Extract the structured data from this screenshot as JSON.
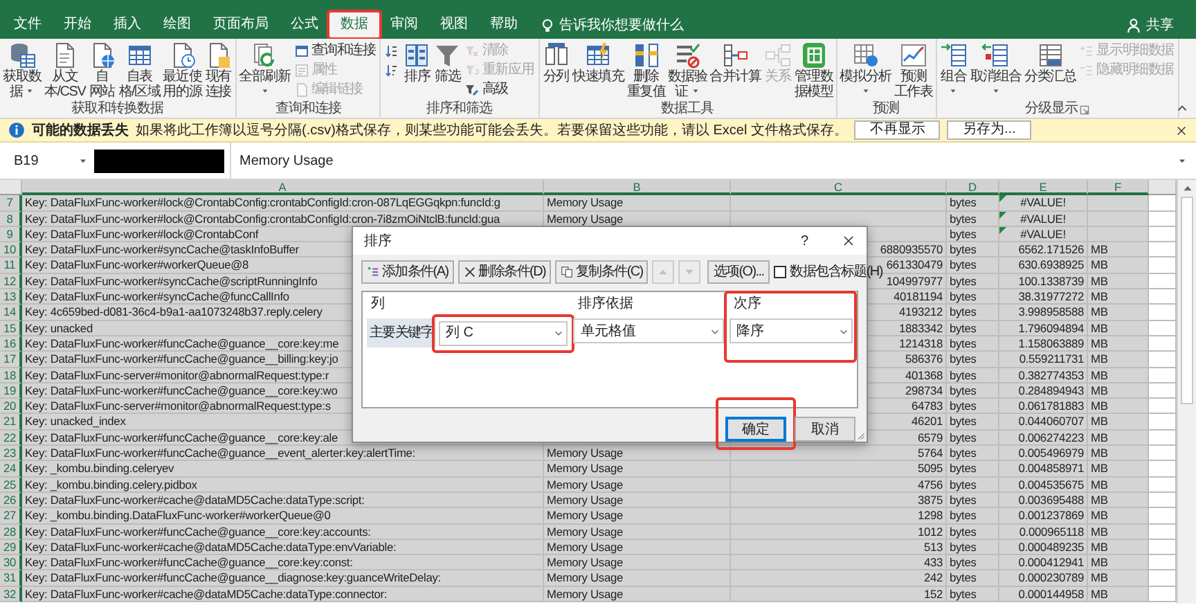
{
  "ribbon_tabs": [
    {
      "label": "文件",
      "selected": false,
      "highlighted": false
    },
    {
      "label": "开始",
      "selected": false,
      "highlighted": false
    },
    {
      "label": "插入",
      "selected": false,
      "highlighted": false
    },
    {
      "label": "绘图",
      "selected": false,
      "highlighted": false
    },
    {
      "label": "页面布局",
      "selected": false,
      "highlighted": false
    },
    {
      "label": "公式",
      "selected": false,
      "highlighted": false
    },
    {
      "label": "数据",
      "selected": true,
      "highlighted": true
    },
    {
      "label": "审阅",
      "selected": false,
      "highlighted": false
    },
    {
      "label": "视图",
      "selected": false,
      "highlighted": false
    },
    {
      "label": "帮助",
      "selected": false,
      "highlighted": false
    }
  ],
  "tell_me": "告诉我你想要做什么",
  "share": "共享",
  "ribbon_groups": [
    {
      "caption": "获取和转换数据",
      "items": [
        {
          "kind": "large",
          "label": [
            "获取数",
            "据"
          ],
          "dropdown": true,
          "disabled": false
        },
        {
          "kind": "large",
          "label": [
            "从文",
            "本/CSV"
          ],
          "dropdown": false,
          "disabled": false
        },
        {
          "kind": "large",
          "label": [
            "自",
            "网站"
          ],
          "dropdown": false,
          "disabled": false
        },
        {
          "kind": "large",
          "label": [
            "自表",
            "格/区域"
          ],
          "dropdown": false,
          "disabled": false
        },
        {
          "kind": "large",
          "label": [
            "最近使",
            "用的源"
          ],
          "dropdown": false,
          "disabled": false
        },
        {
          "kind": "large",
          "label": [
            "现有",
            "连接"
          ],
          "dropdown": false,
          "disabled": false
        }
      ]
    },
    {
      "caption": "查询和连接",
      "items": [
        {
          "kind": "large",
          "label": [
            "全部刷新"
          ],
          "dropdown": true,
          "disabled": false
        },
        {
          "kind": "stack",
          "items": [
            {
              "label": "查询和连接",
              "disabled": false
            },
            {
              "label": "属性",
              "disabled": true
            },
            {
              "label": "编辑链接",
              "disabled": true
            }
          ]
        }
      ]
    },
    {
      "caption": "排序和筛选",
      "items": [
        {
          "kind": "stack",
          "items": [
            {
              "disabled": false
            },
            {
              "disabled": false
            }
          ]
        },
        {
          "kind": "large",
          "label": [
            "排序"
          ],
          "dropdown": false,
          "disabled": false
        },
        {
          "kind": "large",
          "label": [
            "筛选"
          ],
          "dropdown": false,
          "disabled": false
        },
        {
          "kind": "stack",
          "items": [
            {
              "label": "清除",
              "disabled": true
            },
            {
              "label": "重新应用",
              "disabled": true
            },
            {
              "label": "高级",
              "disabled": false
            }
          ]
        }
      ]
    },
    {
      "caption": "数据工具",
      "items": [
        {
          "kind": "large",
          "label": [
            "分列"
          ],
          "dropdown": false,
          "disabled": false
        },
        {
          "kind": "large",
          "label": [
            "快速填充"
          ],
          "dropdown": false,
          "disabled": false
        },
        {
          "kind": "large",
          "label": [
            "删除",
            "重复值"
          ],
          "dropdown": false,
          "disabled": false
        },
        {
          "kind": "large",
          "label": [
            "数据验",
            "证"
          ],
          "dropdown": true,
          "disabled": false
        },
        {
          "kind": "large",
          "label": [
            "合并计算"
          ],
          "dropdown": false,
          "disabled": false
        },
        {
          "kind": "large",
          "label": [
            "关系"
          ],
          "dropdown": false,
          "disabled": true
        },
        {
          "kind": "large",
          "label": [
            "管理数",
            "据模型"
          ],
          "dropdown": false,
          "disabled": false
        }
      ]
    },
    {
      "caption": "预测",
      "items": [
        {
          "kind": "large",
          "label": [
            "模拟分析"
          ],
          "dropdown": true,
          "disabled": false
        },
        {
          "kind": "large",
          "label": [
            "预测",
            "工作表"
          ],
          "dropdown": false,
          "disabled": false
        }
      ]
    },
    {
      "caption": "分级显示",
      "launcher": true,
      "items": [
        {
          "kind": "large",
          "label": [
            "组合"
          ],
          "dropdown": true,
          "disabled": false
        },
        {
          "kind": "large",
          "label": [
            "取消组合"
          ],
          "dropdown": true,
          "disabled": false
        },
        {
          "kind": "large",
          "label": [
            "分类汇总"
          ],
          "dropdown": false,
          "disabled": false
        },
        {
          "kind": "stack",
          "items": [
            {
              "label": "显示明细数据",
              "disabled": true
            },
            {
              "label": "隐藏明细数据",
              "disabled": true
            }
          ]
        }
      ]
    }
  ],
  "notification": {
    "title": "可能的数据丢失",
    "message": "如果将此工作簿以逗号分隔(.csv)格式保存，则某些功能可能会丢失。若要保留这些功能，请以 Excel 文件格式保存。",
    "buttons": [
      "不再显示",
      "另存为..."
    ]
  },
  "formula_bar": {
    "name_box": "B19",
    "formula": "Memory Usage"
  },
  "sheet": {
    "columns": [
      {
        "label": "A",
        "selected": true
      },
      {
        "label": "B",
        "selected": true
      },
      {
        "label": "C",
        "selected": true
      },
      {
        "label": "D",
        "selected": true
      },
      {
        "label": "E",
        "selected": true
      },
      {
        "label": "F",
        "selected": true
      }
    ],
    "rows": [
      {
        "n": "7",
        "selected": true,
        "a": "Key: DataFluxFunc-worker#lock@CrontabConfig:crontabConfigId:cron-087LqEGGqkpn:funcId:g",
        "b": "Memory Usage",
        "d": "bytes",
        "e": "#VALUE!",
        "error": true
      },
      {
        "n": "8",
        "selected": true,
        "a": "Key: DataFluxFunc-worker#lock@CrontabConfig:crontabConfigId:cron-7i8zmOiNtclB:funcId:gua",
        "b": "Memory Usage",
        "d": "bytes",
        "e": "#VALUE!",
        "error": true
      },
      {
        "n": "9",
        "selected": true,
        "a": "Key: DataFluxFunc-worker#lock@CrontabConf",
        "d": "bytes",
        "e": "#VALUE!",
        "error": true
      },
      {
        "n": "10",
        "selected": true,
        "a": "Key: DataFluxFunc-worker#syncCache@taskInfoBuffer",
        "c": "6880935570",
        "d": "bytes",
        "e": "6562.171526",
        "f": "MB",
        "error": false
      },
      {
        "n": "11",
        "selected": true,
        "a": "Key: DataFluxFunc-worker#workerQueue@8",
        "c": "661330479",
        "d": "bytes",
        "e": "630.6938925",
        "f": "MB",
        "error": false
      },
      {
        "n": "12",
        "selected": true,
        "a": "Key: DataFluxFunc-worker#syncCache@scriptRunningInfo",
        "c": "104997977",
        "d": "bytes",
        "e": "100.1338739",
        "f": "MB",
        "error": false
      },
      {
        "n": "13",
        "selected": true,
        "a": "Key: DataFluxFunc-worker#syncCache@funcCallInfo",
        "c": "40181194",
        "d": "bytes",
        "e": "38.31977272",
        "f": "MB",
        "error": false
      },
      {
        "n": "14",
        "selected": true,
        "a": "Key: 4c659bed-d081-36c4-b9a1-aa1073248b37.reply.celery",
        "c": "4193212",
        "d": "bytes",
        "e": "3.998958588",
        "f": "MB",
        "error": false
      },
      {
        "n": "15",
        "selected": true,
        "a": "Key: unacked",
        "c": "1883342",
        "d": "bytes",
        "e": "1.796094894",
        "f": "MB",
        "error": false
      },
      {
        "n": "16",
        "selected": true,
        "a": "Key: DataFluxFunc-worker#funcCache@guance__core:key:me",
        "c": "1214318",
        "d": "bytes",
        "e": "1.158063889",
        "f": "MB",
        "error": false
      },
      {
        "n": "17",
        "selected": true,
        "a": "Key: DataFluxFunc-worker#funcCache@guance__billing:key:jo",
        "c": "586376",
        "d": "bytes",
        "e": "0.559211731",
        "f": "MB",
        "error": false
      },
      {
        "n": "18",
        "selected": true,
        "a": "Key: DataFluxFunc-server#monitor@abnormalRequest:type:r",
        "c": "401368",
        "d": "bytes",
        "e": "0.382774353",
        "f": "MB",
        "error": false
      },
      {
        "n": "19",
        "selected": true,
        "a": "Key: DataFluxFunc-worker#funcCache@guance__core:key:wo",
        "c": "298734",
        "d": "bytes",
        "e": "0.284894943",
        "f": "MB",
        "error": false
      },
      {
        "n": "20",
        "selected": true,
        "a": "Key: DataFluxFunc-server#monitor@abnormalRequest:type:s",
        "c": "64783",
        "d": "bytes",
        "e": "0.061781883",
        "f": "MB",
        "error": false
      },
      {
        "n": "21",
        "selected": true,
        "a": "Key: unacked_index",
        "c": "46201",
        "d": "bytes",
        "e": "0.044060707",
        "f": "MB",
        "error": false
      },
      {
        "n": "22",
        "selected": true,
        "a": "Key: DataFluxFunc-worker#funcCache@guance__core:key:ale",
        "c": "6579",
        "d": "bytes",
        "e": "0.006274223",
        "f": "MB",
        "error": false
      },
      {
        "n": "23",
        "selected": true,
        "a": "Key: DataFluxFunc-worker#funcCache@guance__event_alerter:key:alertTime:",
        "b": "Memory Usage",
        "c": "5764",
        "d": "bytes",
        "e": "0.005496979",
        "f": "MB",
        "error": false
      },
      {
        "n": "24",
        "selected": true,
        "a": "Key: _kombu.binding.celeryev",
        "b": "Memory Usage",
        "c": "5095",
        "d": "bytes",
        "e": "0.004858971",
        "f": "MB",
        "error": false
      },
      {
        "n": "25",
        "selected": true,
        "a": "Key: _kombu.binding.celery.pidbox",
        "b": "Memory Usage",
        "c": "4756",
        "d": "bytes",
        "e": "0.004535675",
        "f": "MB",
        "error": false
      },
      {
        "n": "26",
        "selected": true,
        "a": "Key: DataFluxFunc-worker#cache@dataMD5Cache:dataType:script:",
        "b": "Memory Usage",
        "c": "3875",
        "d": "bytes",
        "e": "0.003695488",
        "f": "MB",
        "error": false
      },
      {
        "n": "27",
        "selected": true,
        "a": "Key: _kombu.binding.DataFluxFunc-worker#workerQueue@0",
        "b": "Memory Usage",
        "c": "1298",
        "d": "bytes",
        "e": "0.001237869",
        "f": "MB",
        "error": false
      },
      {
        "n": "28",
        "selected": true,
        "a": "Key: DataFluxFunc-worker#funcCache@guance__core:key:accounts:",
        "b": "Memory Usage",
        "c": "1012",
        "d": "bytes",
        "e": "0.000965118",
        "f": "MB",
        "error": false
      },
      {
        "n": "29",
        "selected": true,
        "a": "Key: DataFluxFunc-worker#cache@dataMD5Cache:dataType:envVariable:",
        "b": "Memory Usage",
        "c": "513",
        "d": "bytes",
        "e": "0.000489235",
        "f": "MB",
        "error": false
      },
      {
        "n": "30",
        "selected": true,
        "a": "Key: DataFluxFunc-worker#funcCache@guance__core:key:const:",
        "b": "Memory Usage",
        "c": "433",
        "d": "bytes",
        "e": "0.000412941",
        "f": "MB",
        "error": false
      },
      {
        "n": "31",
        "selected": true,
        "a": "Key: DataFluxFunc-worker#funcCache@guance__diagnose:key:guanceWriteDelay:",
        "b": "Memory Usage",
        "c": "242",
        "d": "bytes",
        "e": "0.000230789",
        "f": "MB",
        "error": false
      },
      {
        "n": "32",
        "selected": true,
        "a": "Key: DataFluxFunc-worker#cache@dataMD5Cache:dataType:connector:",
        "b": "Memory Usage",
        "c": "152",
        "d": "bytes",
        "e": "0.000144958",
        "f": "MB",
        "error": false
      }
    ]
  },
  "dialog": {
    "title": "排序",
    "help": "?",
    "toolbar": [
      {
        "kind": "add",
        "label": "添加条件(A)",
        "disabled": false
      },
      {
        "kind": "delete",
        "label": "删除条件(D)",
        "disabled": false
      },
      {
        "kind": "copy",
        "label": "复制条件(C)",
        "disabled": false
      },
      {
        "kind": "up",
        "disabled": true
      },
      {
        "kind": "down",
        "disabled": true
      },
      {
        "kind": "options",
        "label": "选项(O)...",
        "disabled": false
      }
    ],
    "has_headers": {
      "label": "数据包含标题(H)",
      "checked": false
    },
    "columns": [
      {
        "label": "列",
        "highlighted": false
      },
      {
        "label": "排序依据",
        "highlighted": false
      },
      {
        "label": "次序",
        "highlighted": true
      }
    ],
    "levels": [
      {
        "label": "主要关键字",
        "selected": true,
        "fields": [
          {
            "value": "列 C",
            "highlighted": true
          },
          {
            "value": "单元格值",
            "highlighted": false
          },
          {
            "value": "降序",
            "highlighted": false
          }
        ]
      }
    ],
    "buttons": [
      {
        "label": "确定",
        "default": true,
        "highlighted": true
      },
      {
        "label": "取消",
        "default": false,
        "highlighted": false
      }
    ]
  }
}
